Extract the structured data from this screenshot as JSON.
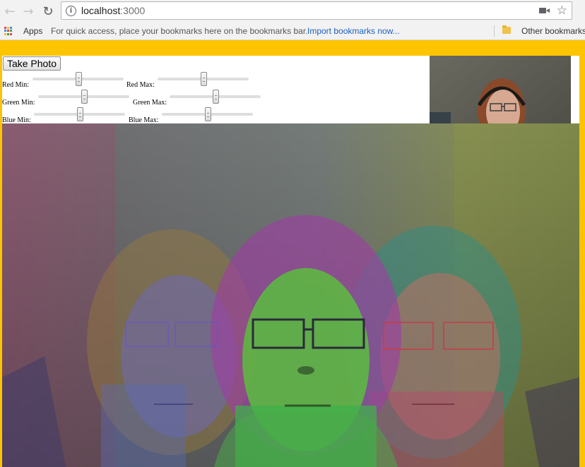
{
  "browser": {
    "url_host": "localhost",
    "url_port": ":3000"
  },
  "bookmarks": {
    "apps_label": "Apps",
    "hint": "For quick access, place your bookmarks here on the bookmarks bar.",
    "import_link": "Import bookmarks now...",
    "other": "Other bookmarks"
  },
  "app": {
    "take_photo_label": "Take Photo",
    "sliders": [
      {
        "label": "Red Min:",
        "value": 0.5
      },
      {
        "label": "Red Max:",
        "value": 0.5
      },
      {
        "label": "Green Min:",
        "value": 0.5
      },
      {
        "label": "Green Max:",
        "value": 0.5
      },
      {
        "label": "Blue Min:",
        "value": 0.5
      },
      {
        "label": "Blue Max:",
        "value": 0.5
      }
    ]
  },
  "icons": {
    "back": "arrow-left-icon",
    "forward": "arrow-right-icon",
    "reload": "reload-icon",
    "info": "info-icon",
    "camera": "camera-icon",
    "star": "star-icon",
    "apps": "apps-grid-icon",
    "folder": "folder-icon"
  },
  "colors": {
    "page_background": "#fdc400",
    "link": "#1a5fc4"
  }
}
